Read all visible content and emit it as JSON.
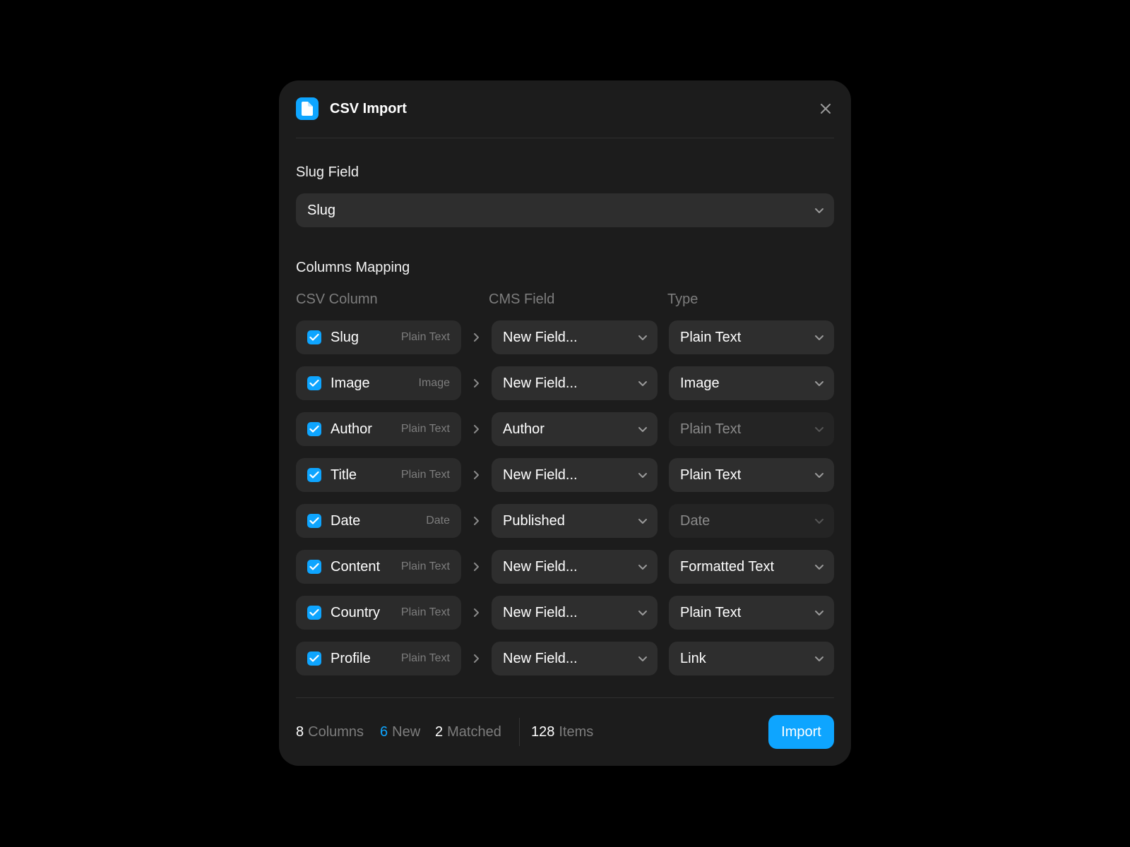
{
  "colors": {
    "accent": "#0ea5ff",
    "background": "#000000",
    "dialog": "#1c1c1c",
    "control": "#2e2e2e"
  },
  "header": {
    "title": "CSV Import",
    "icon": "file-icon",
    "close_icon": "close-icon"
  },
  "slug": {
    "label": "Slug Field",
    "value": "Slug"
  },
  "mapping": {
    "label": "Columns Mapping",
    "columns": {
      "csv": "CSV Column",
      "cms": "CMS Field",
      "type": "Type"
    },
    "rows": [
      {
        "name": "Slug",
        "csv_type": "Plain Text",
        "cms_field": "New Field...",
        "type": "Plain Text",
        "checked": true,
        "type_disabled": false
      },
      {
        "name": "Image",
        "csv_type": "Image",
        "cms_field": "New Field...",
        "type": "Image",
        "checked": true,
        "type_disabled": false
      },
      {
        "name": "Author",
        "csv_type": "Plain Text",
        "cms_field": "Author",
        "type": "Plain Text",
        "checked": true,
        "type_disabled": true
      },
      {
        "name": "Title",
        "csv_type": "Plain Text",
        "cms_field": "New Field...",
        "type": "Plain Text",
        "checked": true,
        "type_disabled": false
      },
      {
        "name": "Date",
        "csv_type": "Date",
        "cms_field": "Published",
        "type": "Date",
        "checked": true,
        "type_disabled": true
      },
      {
        "name": "Content",
        "csv_type": "Plain Text",
        "cms_field": "New Field...",
        "type": "Formatted Text",
        "checked": true,
        "type_disabled": false
      },
      {
        "name": "Country",
        "csv_type": "Plain Text",
        "cms_field": "New Field...",
        "type": "Plain Text",
        "checked": true,
        "type_disabled": false
      },
      {
        "name": "Profile",
        "csv_type": "Plain Text",
        "cms_field": "New Field...",
        "type": "Link",
        "checked": true,
        "type_disabled": false
      }
    ]
  },
  "footer": {
    "columns_count": "8",
    "columns_label": "Columns",
    "new_count": "6",
    "new_label": "New",
    "matched_count": "2",
    "matched_label": "Matched",
    "items_count": "128",
    "items_label": "Items",
    "import_label": "Import"
  }
}
